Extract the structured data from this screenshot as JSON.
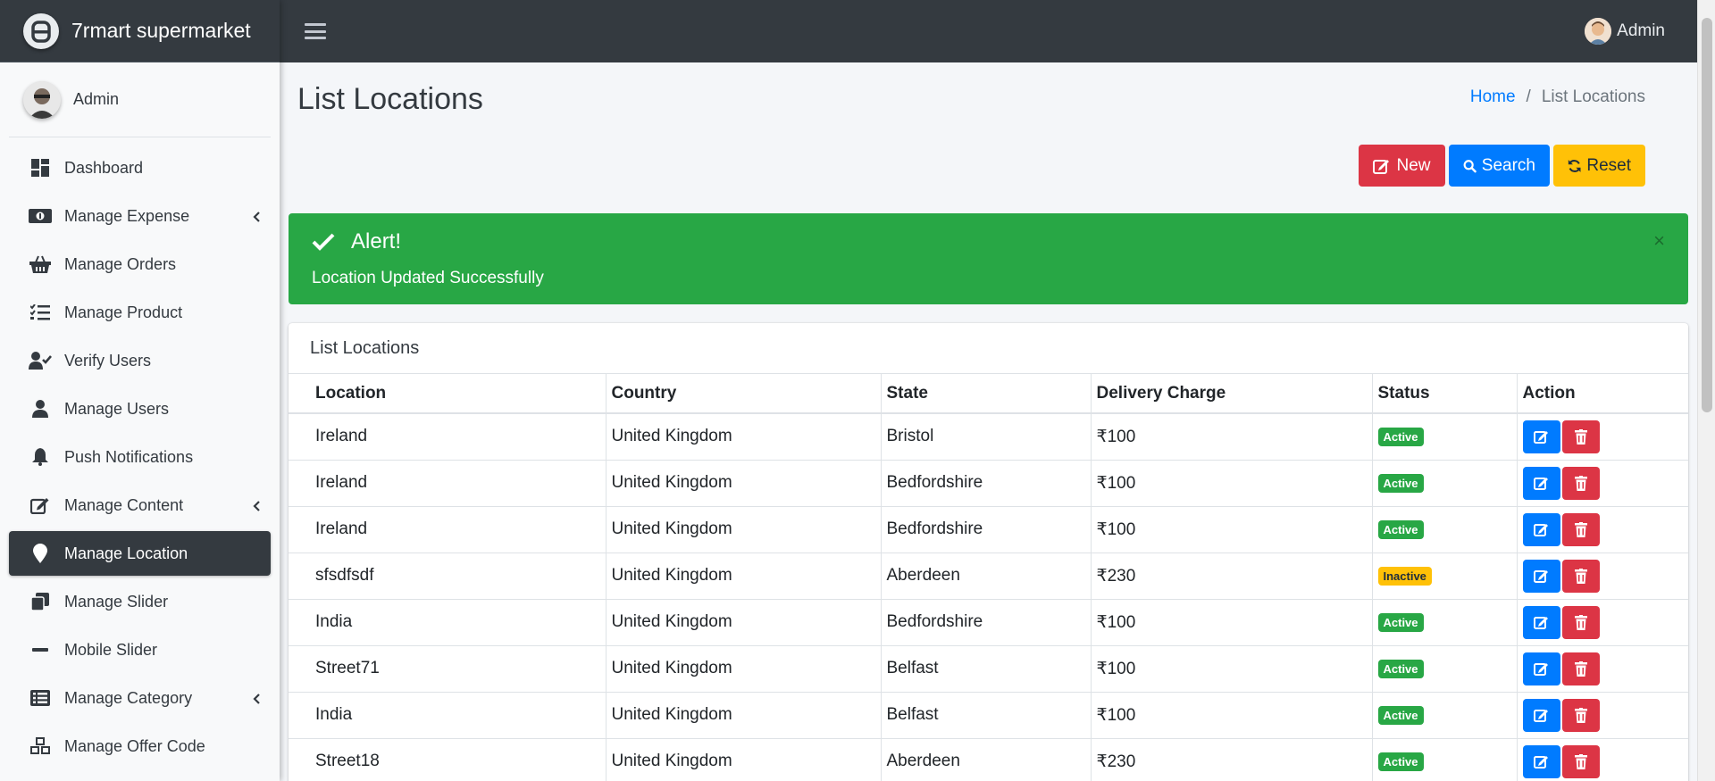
{
  "brand": {
    "name": "7rmart supermarket"
  },
  "sidebar": {
    "user_name": "Admin",
    "items": [
      {
        "label": "Dashboard",
        "icon": "dashboard-icon",
        "has_arrow": false,
        "active": false
      },
      {
        "label": "Manage Expense",
        "icon": "money-icon",
        "has_arrow": true,
        "active": false
      },
      {
        "label": "Manage Orders",
        "icon": "basket-icon",
        "has_arrow": false,
        "active": false
      },
      {
        "label": "Manage Product",
        "icon": "tasks-icon",
        "has_arrow": false,
        "active": false
      },
      {
        "label": "Verify Users",
        "icon": "user-check-icon",
        "has_arrow": false,
        "active": false
      },
      {
        "label": "Manage Users",
        "icon": "user-icon",
        "has_arrow": false,
        "active": false
      },
      {
        "label": "Push Notifications",
        "icon": "bell-icon",
        "has_arrow": false,
        "active": false
      },
      {
        "label": "Manage Content",
        "icon": "edit-icon",
        "has_arrow": true,
        "active": false
      },
      {
        "label": "Manage Location",
        "icon": "map-marker-icon",
        "has_arrow": false,
        "active": true
      },
      {
        "label": "Manage Slider",
        "icon": "clone-icon",
        "has_arrow": false,
        "active": false
      },
      {
        "label": "Mobile Slider",
        "icon": "minus-icon",
        "has_arrow": false,
        "active": false
      },
      {
        "label": "Manage Category",
        "icon": "list-alt-icon",
        "has_arrow": true,
        "active": false
      },
      {
        "label": "Manage Offer Code",
        "icon": "cubes-icon",
        "has_arrow": false,
        "active": false
      }
    ]
  },
  "topbar": {
    "user_name": "Admin"
  },
  "page": {
    "title": "List Locations"
  },
  "breadcrumb": {
    "home": "Home",
    "separator": "/",
    "current": "List Locations"
  },
  "toolbar": {
    "new_label": "New",
    "search_label": "Search",
    "reset_label": "Reset"
  },
  "alert": {
    "title": "Alert!",
    "message": "Location Updated Successfully",
    "close": "×"
  },
  "card": {
    "title": "List Locations"
  },
  "table": {
    "columns": [
      "Location",
      "Country",
      "State",
      "Delivery Charge",
      "Status",
      "Action"
    ],
    "rows": [
      {
        "location": "Ireland",
        "country": "United Kingdom",
        "state": "Bristol",
        "charge": "₹100",
        "status": "Active"
      },
      {
        "location": "Ireland",
        "country": "United Kingdom",
        "state": "Bedfordshire",
        "charge": "₹100",
        "status": "Active"
      },
      {
        "location": "Ireland",
        "country": "United Kingdom",
        "state": "Bedfordshire",
        "charge": "₹100",
        "status": "Active"
      },
      {
        "location": "sfsdfsdf",
        "country": "United Kingdom",
        "state": "Aberdeen",
        "charge": "₹230",
        "status": "Inactive"
      },
      {
        "location": "India",
        "country": "United Kingdom",
        "state": "Bedfordshire",
        "charge": "₹100",
        "status": "Active"
      },
      {
        "location": "Street71",
        "country": "United Kingdom",
        "state": "Belfast",
        "charge": "₹100",
        "status": "Active"
      },
      {
        "location": "India",
        "country": "United Kingdom",
        "state": "Belfast",
        "charge": "₹100",
        "status": "Active"
      },
      {
        "location": "Street18",
        "country": "United Kingdom",
        "state": "Aberdeen",
        "charge": "₹230",
        "status": "Active"
      }
    ]
  },
  "colors": {
    "dark": "#343a40",
    "primary": "#007bff",
    "danger": "#dc3545",
    "warning": "#ffc107",
    "success": "#28a745"
  }
}
